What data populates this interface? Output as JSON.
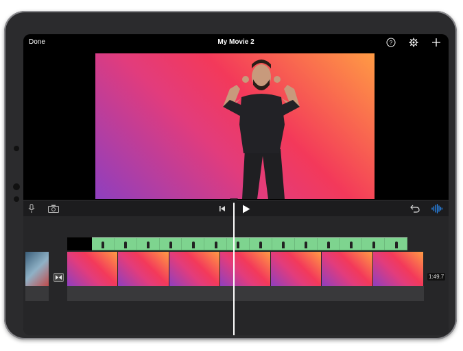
{
  "header": {
    "done_label": "Done",
    "title": "My Movie 2"
  },
  "icons": {
    "help": "question-circle-icon",
    "settings": "gear-icon",
    "add": "plus-icon",
    "mic": "microphone-icon",
    "camera": "camera-icon",
    "skip_back": "skip-to-start-icon",
    "play": "play-icon",
    "undo": "undo-icon",
    "audio": "waveform-icon",
    "transition": "transition-icon"
  },
  "timeline": {
    "duration": "1:49.7"
  },
  "colors": {
    "accent_audio": "#2a8cf5",
    "green_screen_clip": "#7ed48f"
  }
}
